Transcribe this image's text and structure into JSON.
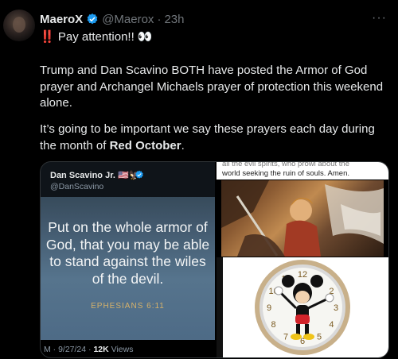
{
  "tweet": {
    "display_name": "MaeroX",
    "handle": "@Maerox",
    "time": "23h",
    "line1_bang": "‼️",
    "line1_text": "Pay attention!! 👀",
    "p2_l1": "Trump and Dan Scavino BOTH have posted the Armor of God",
    "p2_l2": "prayer and Archangel Michaels prayer of protection this weekend",
    "p2_l3": "alone.",
    "p3_l1": "It’s going to be important we say these prayers each day during",
    "p3_l2_pre": "the month of ",
    "p3_l2_bold": "Red October",
    "p3_l2_post": "."
  },
  "media": {
    "left": {
      "name": "Dan Scavino Jr. 🇺🇸🦅",
      "handle": "@DanScavino",
      "quote_l1": "Put on the whole armor of",
      "quote_l2": "God, that you may be able",
      "quote_l3": "to stand against the wiles",
      "quote_l4": "of the devil.",
      "reference": "EPHESIANS 6:11",
      "meta_prefix": "M · 9/27/24 · ",
      "views": "12K",
      "views_label": " Views"
    },
    "right": {
      "text_top": "all the evil spirits, who prowl about the",
      "text_bottom": "world seeking the ruin of souls. Amen.",
      "clock_numbers": [
        "12",
        "1",
        "2",
        "3",
        "4",
        "5",
        "6",
        "7",
        "8",
        "9",
        "10",
        "11"
      ]
    }
  },
  "colors": {
    "verified": "#1d9bf0",
    "accent_red": "#e0245e"
  },
  "icons": {
    "verified": "verified-badge-icon",
    "more": "more-horizontal-icon"
  }
}
